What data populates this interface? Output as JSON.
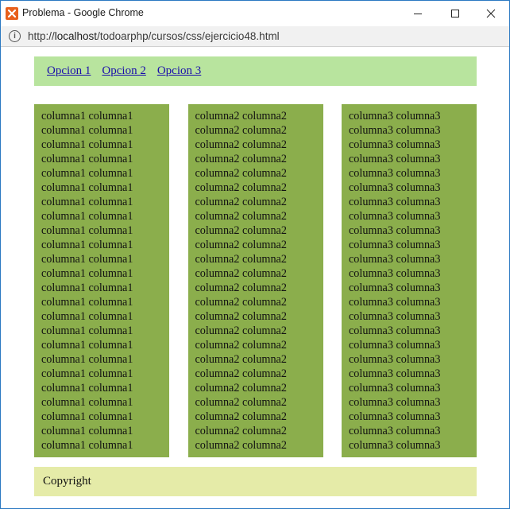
{
  "window": {
    "title": "Problema - Google Chrome",
    "icon": "xampp-icon"
  },
  "addressbar": {
    "url_prefix": "http://",
    "url_host": "localhost",
    "url_path": "/todoarphp/cursos/css/ejercicio48.html"
  },
  "menu": {
    "items": [
      {
        "label": "Opcion 1"
      },
      {
        "label": "Opcion 2"
      },
      {
        "label": "Opcion 3"
      }
    ]
  },
  "columns": [
    {
      "line": "columna1 columna1",
      "lines": 24
    },
    {
      "line": "columna2 columna2",
      "lines": 24
    },
    {
      "line": "columna3 columna3",
      "lines": 24
    }
  ],
  "footer": {
    "text": "Copyright"
  },
  "colors": {
    "menu_bg": "#b8e49e",
    "column_bg": "#8bae4c",
    "footer_bg": "#e5eba8",
    "link": "#1a0dab"
  }
}
